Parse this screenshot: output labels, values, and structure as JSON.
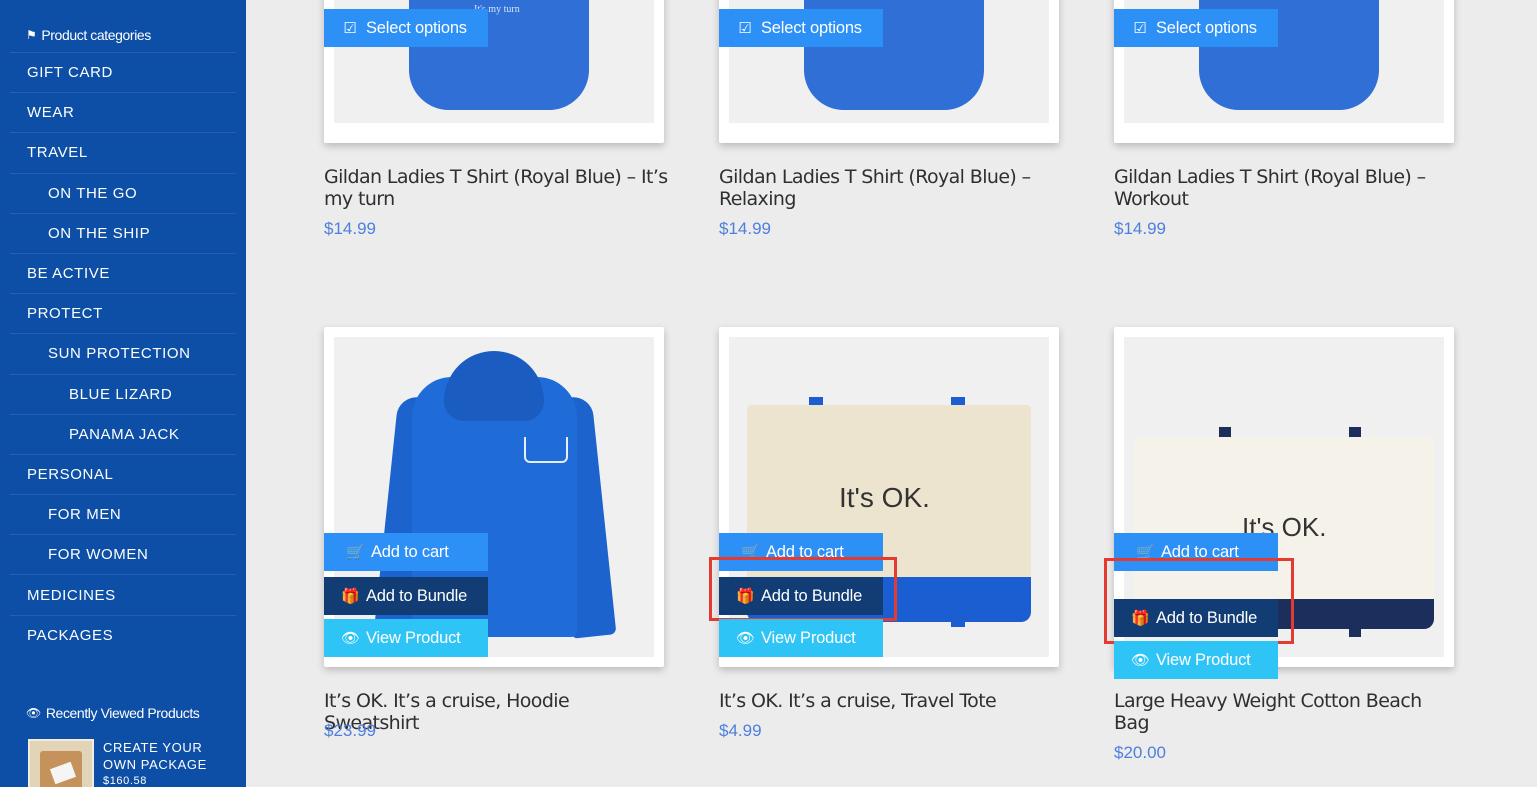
{
  "sidebar": {
    "categories_heading": "Product categories",
    "categories": [
      {
        "label": "GIFT CARD",
        "level": 0
      },
      {
        "label": "WEAR",
        "level": 0
      },
      {
        "label": "TRAVEL",
        "level": 0
      },
      {
        "label": "ON THE GO",
        "level": 1
      },
      {
        "label": "ON THE SHIP",
        "level": 1
      },
      {
        "label": "BE ACTIVE",
        "level": 0
      },
      {
        "label": "PROTECT",
        "level": 0
      },
      {
        "label": "SUN PROTECTION",
        "level": 1
      },
      {
        "label": "BLUE LIZARD",
        "level": 2
      },
      {
        "label": "PANAMA JACK",
        "level": 2
      },
      {
        "label": "PERSONAL",
        "level": 0
      },
      {
        "label": "FOR MEN",
        "level": 1
      },
      {
        "label": "FOR WOMEN",
        "level": 1
      },
      {
        "label": "MEDICINES",
        "level": 0
      },
      {
        "label": "PACKAGES",
        "level": 0
      }
    ],
    "recent_heading": "Recently Viewed Products",
    "recent_items": [
      {
        "name_line1": "CREATE YOUR",
        "name_line2": "OWN PACKAGE",
        "price": "$160.58"
      }
    ]
  },
  "buttons": {
    "select_options": "Select options",
    "add_to_cart": "Add to cart",
    "add_to_bundle": "Add to Bundle",
    "view_product": "View Product"
  },
  "products": [
    {
      "name": "Gildan Ladies T Shirt (Royal Blue) – It’s my turn",
      "price": "$14.99",
      "image_text": "It's my turn"
    },
    {
      "name": "Gildan Ladies T Shirt (Royal Blue) – Relaxing",
      "price": "$14.99"
    },
    {
      "name": "Gildan Ladies T Shirt (Royal Blue) – Workout",
      "price": "$14.99"
    },
    {
      "name": "It’s OK. It’s a cruise, Hoodie Sweatshirt",
      "price": "$23.99"
    },
    {
      "name": "It’s OK. It’s a cruise, Travel Tote",
      "price": "$4.99",
      "image_text": "It's OK."
    },
    {
      "name": "Large Heavy Weight Cotton Beach Bag",
      "price": "$20.00",
      "image_text": "It's OK."
    }
  ],
  "colors": {
    "sidebar_bg": "#0d4fa6",
    "button_primary": "#2c90f6",
    "button_bundle": "#123d74",
    "button_view": "#2ec5f6",
    "price": "#4d7fde",
    "highlight": "#e53a2f"
  },
  "icons": {
    "categories": "bookmark-icon",
    "recent": "eye-icon",
    "select": "checkbox-icon",
    "cart": "cart-icon",
    "bundle": "gift-icon",
    "view": "eye-icon"
  }
}
